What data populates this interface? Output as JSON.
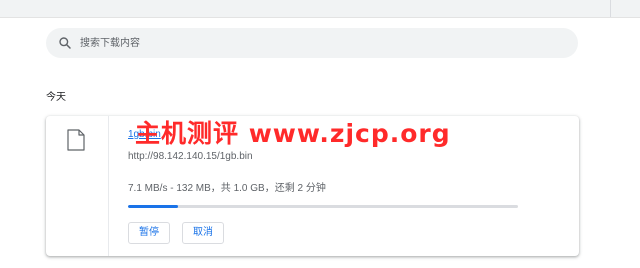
{
  "search": {
    "placeholder": "搜索下载内容",
    "icon": "search-icon"
  },
  "section": {
    "date_label": "今天"
  },
  "download": {
    "file_name": "1gb.bin",
    "url": "http://98.142.140.15/1gb.bin",
    "status": "7.1 MB/s - 132 MB，共 1.0 GB，还剩 2 分钟",
    "progress_fraction": 0.129,
    "pause_label": "暂停",
    "cancel_label": "取消",
    "file_icon": "file-icon"
  },
  "watermark": {
    "text": "主机测评 www.zjcp.org"
  },
  "colors": {
    "accent": "#1a73e8",
    "watermark": "#ff2a2a",
    "topbar": "#f1f3f4",
    "search_bg": "#f1f3f4",
    "progress_track": "#dadce0"
  }
}
